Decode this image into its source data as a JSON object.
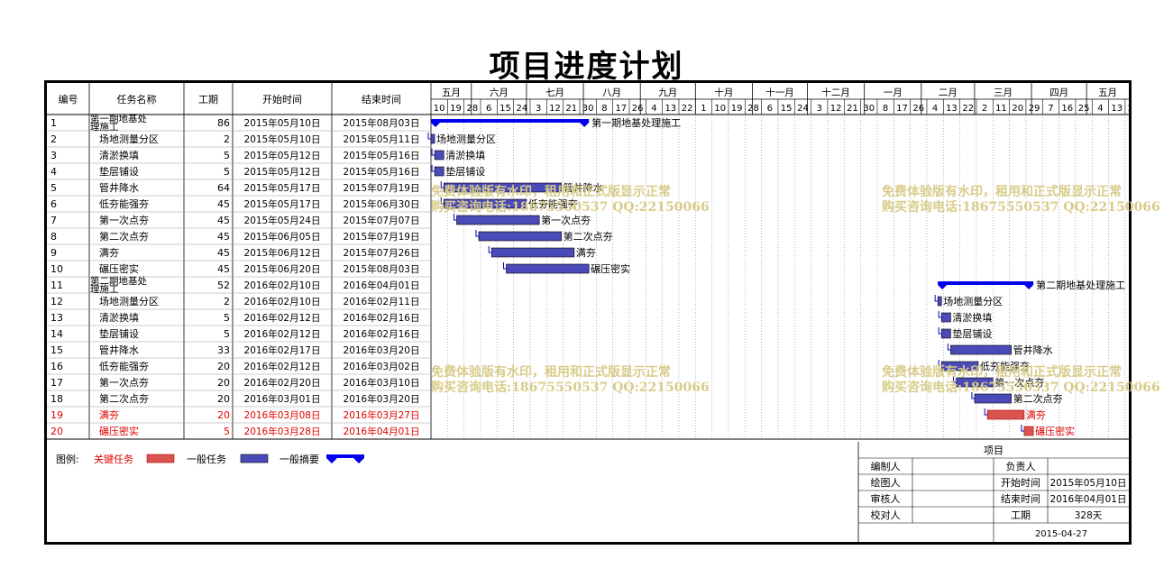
{
  "title": "项目进度计划",
  "table_headers": [
    "编号",
    "任务名称",
    "工期",
    "开始时间",
    "结束时间"
  ],
  "timeline": {
    "months": [
      "五月",
      "六月",
      "七月",
      "八月",
      "九月",
      "十月",
      "十一月",
      "十二月",
      "一月",
      "二月",
      "三月",
      "四月",
      "五月"
    ],
    "days": [
      "10",
      "19",
      "28",
      "6",
      "15",
      "24",
      "3",
      "12",
      "21",
      "30",
      "8",
      "17",
      "26",
      "4",
      "13",
      "22",
      "1",
      "10",
      "19",
      "28",
      "6",
      "15",
      "24",
      "3",
      "12",
      "21",
      "30",
      "8",
      "17",
      "26",
      "4",
      "13",
      "22",
      "2",
      "11",
      "20",
      "29",
      "7",
      "16",
      "25",
      "4",
      "13",
      "22"
    ]
  },
  "chart_data": {
    "type": "gantt",
    "title": "项目进度计划",
    "x_start": "2015-05-10",
    "x_end": "2016-05-24",
    "tasks": [
      {
        "id": "1",
        "name": "第一期地基处理施工",
        "duration": "86",
        "start": "2015年05月10日",
        "end": "2015年08月03日",
        "s": "2015-05-10",
        "e": "2015-08-03",
        "kind": "summary",
        "label": "第一期地基处理施工"
      },
      {
        "id": "2",
        "name": "场地测量分区",
        "duration": "2",
        "start": "2015年05月10日",
        "end": "2015年05月11日",
        "s": "2015-05-10",
        "e": "2015-05-11",
        "kind": "normal",
        "label": "场地测量分区"
      },
      {
        "id": "3",
        "name": "清淤换填",
        "duration": "5",
        "start": "2015年05月12日",
        "end": "2015年05月16日",
        "s": "2015-05-12",
        "e": "2015-05-16",
        "kind": "normal",
        "label": "清淤换填"
      },
      {
        "id": "4",
        "name": "垫层铺设",
        "duration": "5",
        "start": "2015年05月12日",
        "end": "2015年05月16日",
        "s": "2015-05-12",
        "e": "2015-05-16",
        "kind": "normal",
        "label": "垫层铺设"
      },
      {
        "id": "5",
        "name": "管井降水",
        "duration": "64",
        "start": "2015年05月17日",
        "end": "2015年07月19日",
        "s": "2015-05-17",
        "e": "2015-07-19",
        "kind": "normal",
        "label": "管井降水"
      },
      {
        "id": "6",
        "name": "低夯能强夯",
        "duration": "45",
        "start": "2015年05月17日",
        "end": "2015年06月30日",
        "s": "2015-05-17",
        "e": "2015-06-30",
        "kind": "normal",
        "label": "低夯能强夯"
      },
      {
        "id": "7",
        "name": "第一次点夯",
        "duration": "45",
        "start": "2015年05月24日",
        "end": "2015年07月07日",
        "s": "2015-05-24",
        "e": "2015-07-07",
        "kind": "normal",
        "label": "第一次点夯"
      },
      {
        "id": "8",
        "name": "第二次点夯",
        "duration": "45",
        "start": "2015年06月05日",
        "end": "2015年07月19日",
        "s": "2015-06-05",
        "e": "2015-07-19",
        "kind": "normal",
        "label": "第二次点夯"
      },
      {
        "id": "9",
        "name": "满夯",
        "duration": "45",
        "start": "2015年06月12日",
        "end": "2015年07月26日",
        "s": "2015-06-12",
        "e": "2015-07-26",
        "kind": "normal",
        "label": "满夯"
      },
      {
        "id": "10",
        "name": "碾压密实",
        "duration": "45",
        "start": "2015年06月20日",
        "end": "2015年08月03日",
        "s": "2015-06-20",
        "e": "2015-08-03",
        "kind": "normal",
        "label": "碾压密实"
      },
      {
        "id": "11",
        "name": "第二期地基处理施工",
        "duration": "52",
        "start": "2016年02月10日",
        "end": "2016年04月01日",
        "s": "2016-02-10",
        "e": "2016-04-01",
        "kind": "summary",
        "label": "第二期地基处理施工"
      },
      {
        "id": "12",
        "name": "场地测量分区",
        "duration": "2",
        "start": "2016年02月10日",
        "end": "2016年02月11日",
        "s": "2016-02-10",
        "e": "2016-02-11",
        "kind": "normal",
        "label": "场地测量分区"
      },
      {
        "id": "13",
        "name": "清淤换填",
        "duration": "5",
        "start": "2016年02月12日",
        "end": "2016年02月16日",
        "s": "2016-02-12",
        "e": "2016-02-16",
        "kind": "normal",
        "label": "清淤换填"
      },
      {
        "id": "14",
        "name": "垫层铺设",
        "duration": "5",
        "start": "2016年02月12日",
        "end": "2016年02月16日",
        "s": "2016-02-12",
        "e": "2016-02-16",
        "kind": "normal",
        "label": "垫层铺设"
      },
      {
        "id": "15",
        "name": "管井降水",
        "duration": "33",
        "start": "2016年02月17日",
        "end": "2016年03月20日",
        "s": "2016-02-17",
        "e": "2016-03-20",
        "kind": "normal",
        "label": "管井降水"
      },
      {
        "id": "16",
        "name": "低夯能强夯",
        "duration": "20",
        "start": "2016年02月12日",
        "end": "2016年03月02日",
        "s": "2016-02-12",
        "e": "2016-03-02",
        "kind": "normal",
        "label": "低夯能强夯"
      },
      {
        "id": "17",
        "name": "第一次点夯",
        "duration": "20",
        "start": "2016年02月20日",
        "end": "2016年03月10日",
        "s": "2016-02-20",
        "e": "2016-03-10",
        "kind": "normal",
        "label": "第一次点夯"
      },
      {
        "id": "18",
        "name": "第二次点夯",
        "duration": "20",
        "start": "2016年03月01日",
        "end": "2016年03月20日",
        "s": "2016-03-01",
        "e": "2016-03-20",
        "kind": "normal",
        "label": "第二次点夯"
      },
      {
        "id": "19",
        "name": "满夯",
        "duration": "20",
        "start": "2016年03月08日",
        "end": "2016年03月27日",
        "s": "2016-03-08",
        "e": "2016-03-27",
        "kind": "critical",
        "label": "满夯"
      },
      {
        "id": "20",
        "name": "碾压密实",
        "duration": "5",
        "start": "2016年03月28日",
        "end": "2016年04月01日",
        "s": "2016-03-28",
        "e": "2016-04-01",
        "kind": "critical",
        "label": "碾压密实"
      }
    ]
  },
  "legend": {
    "prefix": "图例:",
    "critical": "关键任务",
    "normal": "一般任务",
    "summary": "一般摘要"
  },
  "info": {
    "project_label": "项目",
    "editor": "编制人",
    "owner": "负责人",
    "drafter": "绘图人",
    "start_label": "开始时间",
    "start_value": "2015年05月10日",
    "reviewer": "审核人",
    "end_label": "结束时间",
    "end_value": "2016年04月01日",
    "checker": "校对人",
    "duration_label": "工期",
    "duration_value": "328天",
    "date": "2015-04-27"
  },
  "watermark": {
    "line1": "免费体验版有水印，租用和正式版显示正常",
    "line2": "购买咨询电话:18675550537 QQ:22150066"
  },
  "colors": {
    "summary": "#0000ee",
    "normal_fill": "#4a4ab8",
    "critical_fill": "#d9534f",
    "critical_text": "#e00000"
  }
}
